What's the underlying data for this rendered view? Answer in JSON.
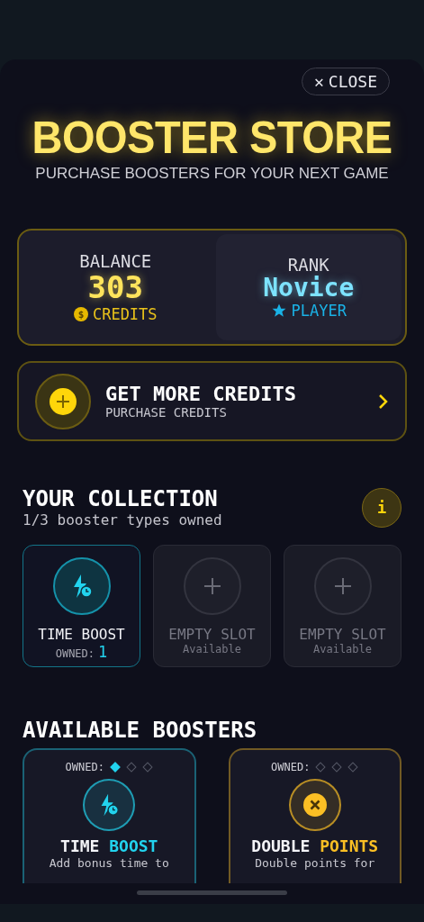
{
  "close_button": {
    "icon": "✕",
    "label": "CLOSE"
  },
  "header": {
    "title": "BOOSTER STORE",
    "subtitle": "PURCHASE BOOSTERS FOR YOUR NEXT GAME"
  },
  "stats": {
    "balance": {
      "label": "BALANCE",
      "value": "303",
      "coin": "$",
      "unit": "CREDITS"
    },
    "rank": {
      "label": "RANK",
      "value": "Novice",
      "tier": "PLAYER"
    }
  },
  "get_credits": {
    "title": "GET MORE CREDITS",
    "subtitle": "PURCHASE CREDITS"
  },
  "collection": {
    "title": "YOUR COLLECTION",
    "subtitle": "1/3 booster types owned",
    "info": "i",
    "slots": [
      {
        "kind": "owned",
        "name": "TIME BOOST",
        "owned_label": "OWNED:",
        "owned_count": "1"
      },
      {
        "kind": "empty",
        "name": "EMPTY SLOT",
        "status": "Available"
      },
      {
        "kind": "empty",
        "name": "EMPTY SLOT",
        "status": "Available"
      }
    ]
  },
  "available": {
    "title": "AVAILABLE BOOSTERS",
    "boosters": [
      {
        "kind": "time",
        "owned_label": "OWNED:",
        "pips": [
          {
            "filled": true
          },
          {
            "filled": false
          },
          {
            "filled": false
          }
        ],
        "title": "TIME",
        "title_accent": "BOOST",
        "description": "Add bonus time to",
        "color": "#22d3ee"
      },
      {
        "kind": "double",
        "owned_label": "OWNED:",
        "pips": [
          {
            "filled": false
          },
          {
            "filled": false
          },
          {
            "filled": false
          }
        ],
        "title": "DOUBLE",
        "title_accent": "POINTS",
        "description": "Double points for",
        "color": "#fbbf24"
      }
    ]
  }
}
